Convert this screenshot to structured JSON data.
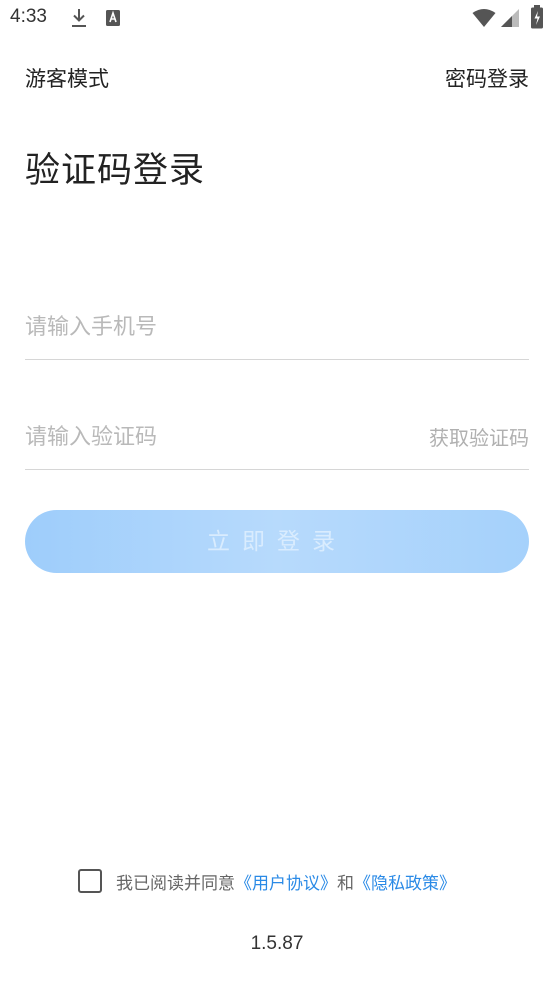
{
  "status_bar": {
    "time": "4:33",
    "icons": [
      "download-icon",
      "keyboard-icon",
      "wifi-icon",
      "signal-icon",
      "battery-icon"
    ]
  },
  "top_nav": {
    "guest_mode": "游客模式",
    "password_login": "密码登录"
  },
  "title": "验证码登录",
  "phone_field": {
    "value": "",
    "placeholder": "请输入手机号"
  },
  "code_field": {
    "value": "",
    "placeholder": "请输入验证码",
    "get_code_label": "获取验证码"
  },
  "login_button": {
    "label": "立即登录",
    "enabled": false
  },
  "agreement": {
    "checked": false,
    "prefix": "我已阅读并同意",
    "user_agreement": "《用户协议》",
    "conjunction": "和",
    "privacy_policy": "《隐私政策》"
  },
  "version": "1.5.87",
  "colors": {
    "accent": "#2a8ae6",
    "button_bg": "#a9d3fb",
    "button_text": "#d9ecfe",
    "placeholder": "#b9b9b9"
  }
}
